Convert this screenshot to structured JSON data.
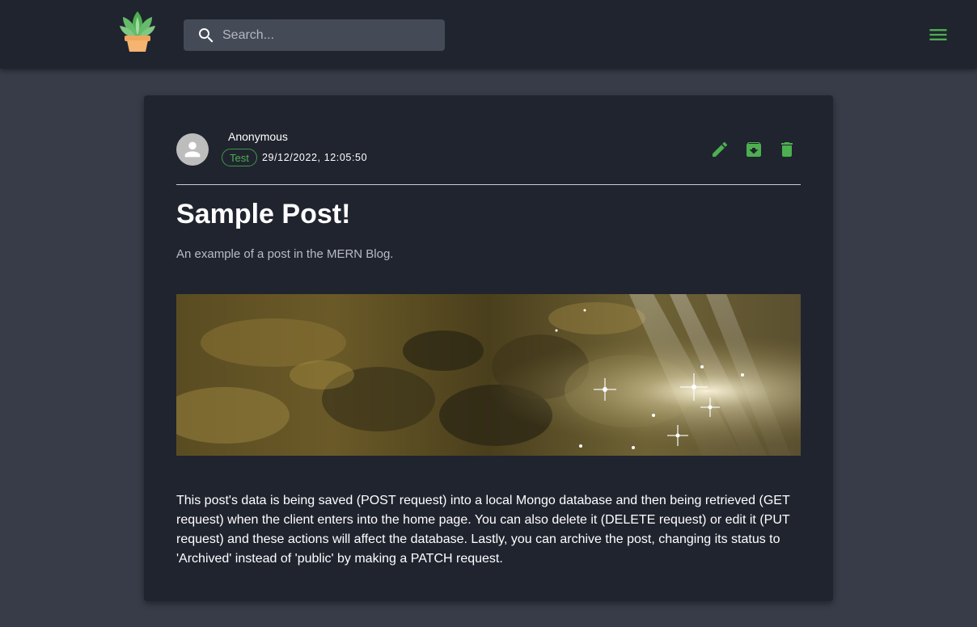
{
  "header": {
    "logo_icon": "potted-plant-icon",
    "search": {
      "placeholder": "Search...",
      "value": "",
      "icon": "search-icon"
    },
    "menu_icon": "hamburger-menu-icon"
  },
  "post": {
    "author": "Anonymous",
    "tag": "Test",
    "date": "29/12/2022, 12:05:50",
    "actions": [
      "edit-icon",
      "archive-icon",
      "delete-icon"
    ],
    "title": "Sample Post!",
    "subtitle": "An example of a post in the MERN Blog.",
    "body": "This post's data is being saved (POST request) into a local Mongo database and then being retrieved (GET request) when the client enters into the home page. You can also delete it (DELETE request) or edit it (PUT request) and these actions will affect the database. Lastly, you can archive the post, changing its status to 'Archived' instead of 'public' by making a PATCH request."
  },
  "colors": {
    "accent": "#4caf50",
    "appbar": "#20242f",
    "background": "#373c48",
    "card": "#20242f"
  }
}
